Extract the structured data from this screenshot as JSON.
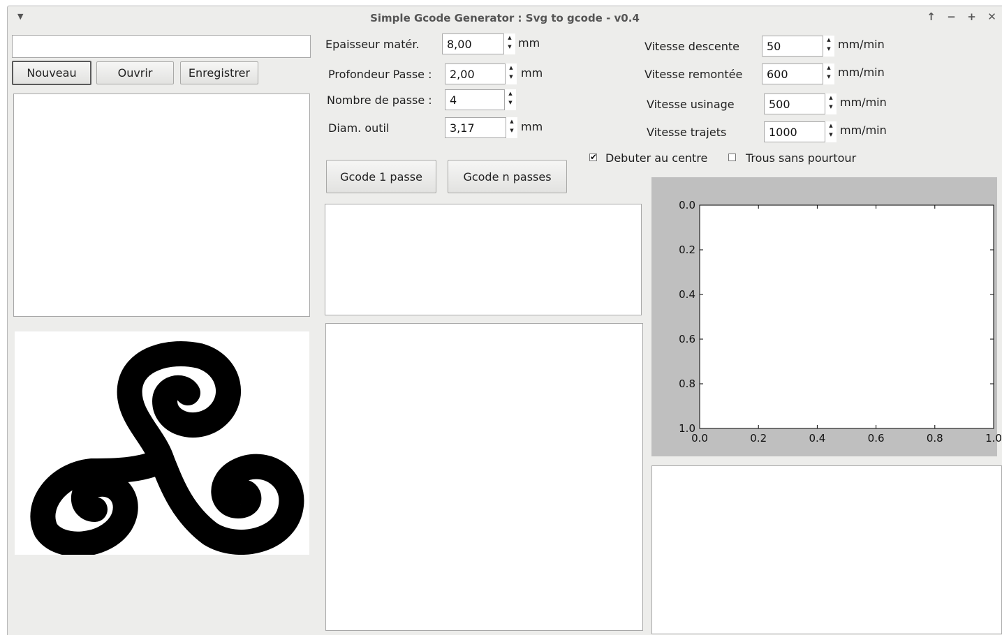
{
  "window": {
    "title": "Simple Gcode Generator : Svg to gcode - v0.4",
    "menu_icon": "triangle-down-icon",
    "controls": [
      "↑",
      "−",
      "+",
      "✕"
    ]
  },
  "file": {
    "path_value": "",
    "new_label": "Nouveau",
    "open_label": "Ouvrir",
    "save_label": "Enregistrer"
  },
  "params": {
    "thickness": {
      "label": "Epaisseur matér.",
      "value": "8,00",
      "unit": "mm"
    },
    "pass_depth": {
      "label": "Profondeur Passe :",
      "value": "2,00",
      "unit": "mm"
    },
    "pass_count": {
      "label": "Nombre de passe :",
      "value": "4"
    },
    "tool_diam": {
      "label": "Diam. outil",
      "value": "3,17",
      "unit": "mm"
    }
  },
  "speeds": {
    "descent": {
      "label": "Vitesse descente",
      "value": "50",
      "unit": "mm/min"
    },
    "ascent": {
      "label": "Vitesse remontée",
      "value": "600",
      "unit": "mm/min"
    },
    "machining": {
      "label": "Vitesse usinage",
      "value": "500",
      "unit": "mm/min"
    },
    "travel": {
      "label": "Vitesse trajets",
      "value": "1000",
      "unit": "mm/min"
    }
  },
  "options": {
    "start_center": {
      "label": "Debuter au centre",
      "checked": true
    },
    "holes_no_contour": {
      "label": "Trous sans pourtour",
      "checked": false
    }
  },
  "actions": {
    "gcode_one": "Gcode 1 passe",
    "gcode_n": "Gcode n passes"
  },
  "preview_icon": "triskelion-icon",
  "chart_data": {
    "type": "line",
    "series": [],
    "xlim": [
      0.0,
      1.0
    ],
    "ylim": [
      0.0,
      1.0
    ],
    "y_inverted": true,
    "x_ticks": [
      "0.0",
      "0.2",
      "0.4",
      "0.6",
      "0.8",
      "1.0"
    ],
    "y_ticks": [
      "0.0",
      "0.2",
      "0.4",
      "0.6",
      "0.8",
      "1.0"
    ],
    "title": "",
    "xlabel": "",
    "ylabel": "",
    "grid": false
  }
}
